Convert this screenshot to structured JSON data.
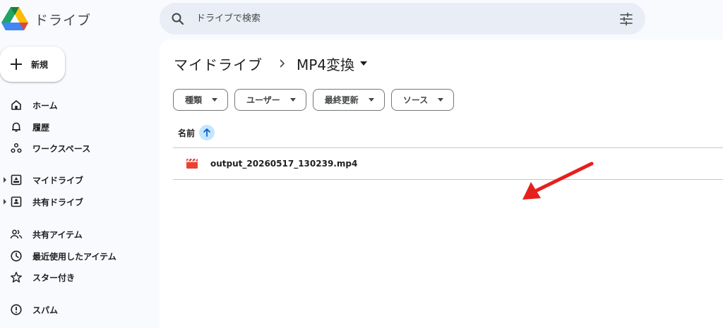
{
  "app": {
    "title": "ドライブ"
  },
  "search": {
    "placeholder": "ドライブで検索",
    "value": ""
  },
  "new_button": {
    "label": "新規"
  },
  "sidebar": {
    "items": [
      {
        "label": "ホーム",
        "icon": "home-icon"
      },
      {
        "label": "履歴",
        "icon": "bell-icon"
      },
      {
        "label": "ワークスペース",
        "icon": "workspaces-icon"
      },
      {
        "label": "マイドライブ",
        "icon": "my-drive-icon",
        "expandable": true
      },
      {
        "label": "共有ドライブ",
        "icon": "shared-drives-icon",
        "expandable": true
      },
      {
        "label": "共有アイテム",
        "icon": "people-icon"
      },
      {
        "label": "最近使用したアイテム",
        "icon": "clock-icon"
      },
      {
        "label": "スター付き",
        "icon": "star-icon"
      },
      {
        "label": "スパム",
        "icon": "spam-icon"
      }
    ]
  },
  "breadcrumb": {
    "root": "マイドライブ",
    "current": "MP4変換"
  },
  "filters": [
    {
      "label": "種類"
    },
    {
      "label": "ユーザー"
    },
    {
      "label": "最終更新"
    },
    {
      "label": "ソース"
    }
  ],
  "table": {
    "column_name": "名前",
    "sort_direction": "ascending",
    "rows": [
      {
        "name": "output_20260517_130239.mp4",
        "icon": "video-file-icon"
      }
    ]
  },
  "colors": {
    "page_bg": "#f8fafd",
    "search_bg": "#e9eef6",
    "sort_chip": "#c2e7ff",
    "annotation_arrow": "#e5201c",
    "video_icon": "#ea4335"
  }
}
